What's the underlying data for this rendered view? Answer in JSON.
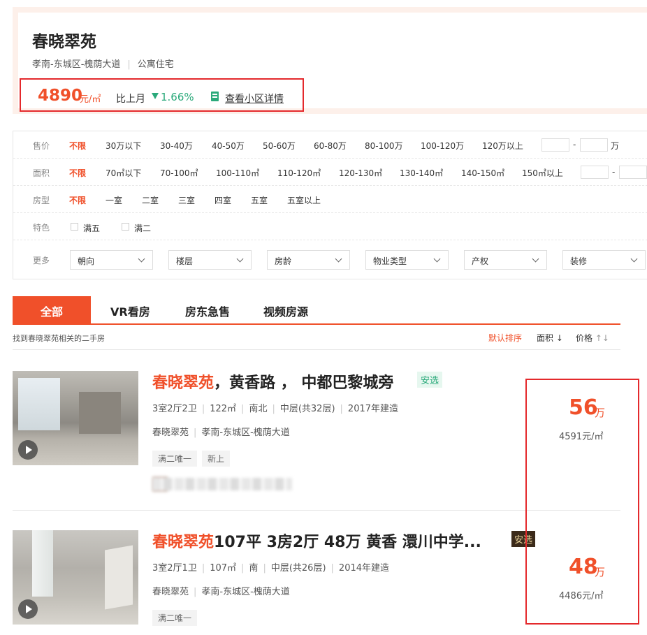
{
  "estate": {
    "name": "春晓翠苑",
    "location": "孝南-东城区-槐荫大道",
    "type": "公寓住宅",
    "avg_price": "4890",
    "avg_price_unit": "元/㎡",
    "mom_label": "比上月",
    "mom_change": "1.66%",
    "detail_link": "查看小区详情"
  },
  "filters": {
    "price": {
      "label": "售价",
      "options": [
        "不限",
        "30万以下",
        "30-40万",
        "40-50万",
        "50-60万",
        "60-80万",
        "80-100万",
        "100-120万",
        "120万以上"
      ],
      "unit": "万"
    },
    "area": {
      "label": "面积",
      "options": [
        "不限",
        "70㎡以下",
        "70-100㎡",
        "100-110㎡",
        "110-120㎡",
        "120-130㎡",
        "130-140㎡",
        "140-150㎡",
        "150㎡以上"
      ]
    },
    "rooms": {
      "label": "房型",
      "options": [
        "不限",
        "一室",
        "二室",
        "三室",
        "四室",
        "五室",
        "五室以上"
      ]
    },
    "features": {
      "label": "特色",
      "options": [
        "满五",
        "满二"
      ]
    },
    "more": {
      "label": "更多",
      "dropdowns": [
        "朝向",
        "楼层",
        "房龄",
        "物业类型",
        "产权",
        "装修"
      ]
    }
  },
  "tabs": [
    "全部",
    "VR看房",
    "房东急售",
    "视频房源"
  ],
  "results": {
    "found_text": "找到春晓翠苑相关的二手房",
    "sort": [
      "默认排序",
      "面积",
      "价格"
    ]
  },
  "listings": [
    {
      "title_highlight": "春晓翠苑",
      "title_rest": "，黄香路 ， 中都巴黎城旁",
      "badge": "安选",
      "attrs": [
        "3室2厅2卫",
        "122㎡",
        "南北",
        "中层(共32层)",
        "2017年建造"
      ],
      "community": "春晓翠苑",
      "district": "孝南-东城区-槐荫大道",
      "tags": [
        "满二唯一",
        "新上"
      ],
      "total": "56",
      "total_unit": "万",
      "unit_price": "4591元/㎡"
    },
    {
      "title_highlight": "春晓翠苑",
      "title_rest": "107平 3房2厅 48万 黄香 澴川中学...",
      "badge": "安选",
      "attrs": [
        "3室2厅1卫",
        "107㎡",
        "南",
        "中层(共26层)",
        "2014年建造"
      ],
      "community": "春晓翠苑",
      "district": "孝南-东城区-槐荫大道",
      "tags": [
        "满二唯一"
      ],
      "total": "48",
      "total_unit": "万",
      "unit_price": "4486元/㎡"
    }
  ],
  "colors": {
    "accent": "#f0502a",
    "green": "#2aa97a",
    "highlight_border": "#e4292c"
  }
}
